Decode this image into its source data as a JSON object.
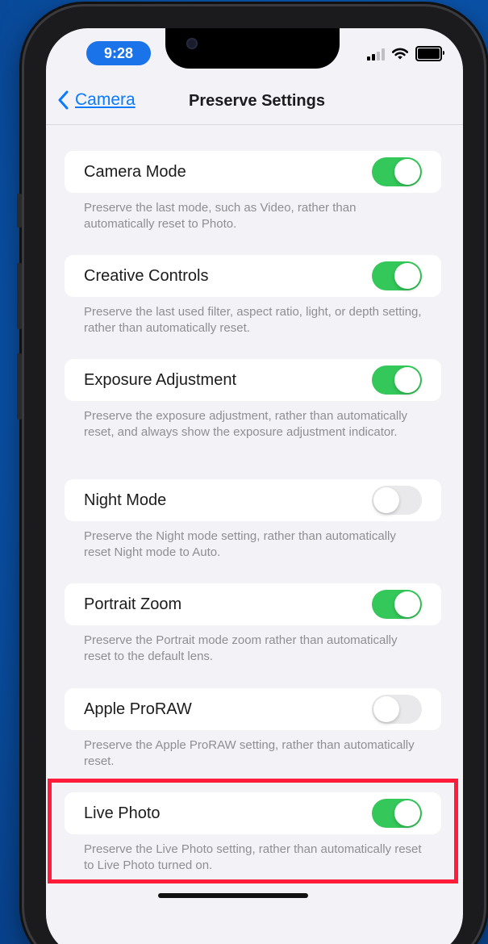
{
  "status_bar": {
    "time": "9:28"
  },
  "nav": {
    "back_label": "Camera",
    "title": "Preserve Settings"
  },
  "settings": [
    {
      "label": "Camera Mode",
      "enabled": true,
      "description": "Preserve the last mode, such as Video, rather than automatically reset to Photo."
    },
    {
      "label": "Creative Controls",
      "enabled": true,
      "description": "Preserve the last used filter, aspect ratio, light, or depth setting, rather than automatically reset."
    },
    {
      "label": "Exposure Adjustment",
      "enabled": true,
      "description": "Preserve the exposure adjustment, rather than automatically reset, and always show the exposure adjustment indicator."
    },
    {
      "label": "Night Mode",
      "enabled": false,
      "description": "Preserve the Night mode setting, rather than automatically reset Night mode to Auto."
    },
    {
      "label": "Portrait Zoom",
      "enabled": true,
      "description": "Preserve the Portrait mode zoom rather than automatically reset to the default lens."
    },
    {
      "label": "Apple ProRAW",
      "enabled": false,
      "description": "Preserve the Apple ProRAW setting, rather than automatically reset."
    },
    {
      "label": "Live Photo",
      "enabled": true,
      "description": "Preserve the Live Photo setting, rather than automatically reset to Live Photo turned on."
    }
  ],
  "colors": {
    "accent": "#0a7aff",
    "toggle_on": "#34c759",
    "toggle_off": "#e9e9eb",
    "highlight": "#ff1d3b"
  },
  "icons": [
    "chevron-left-icon",
    "signal-icon",
    "wifi-icon",
    "battery-icon"
  ]
}
